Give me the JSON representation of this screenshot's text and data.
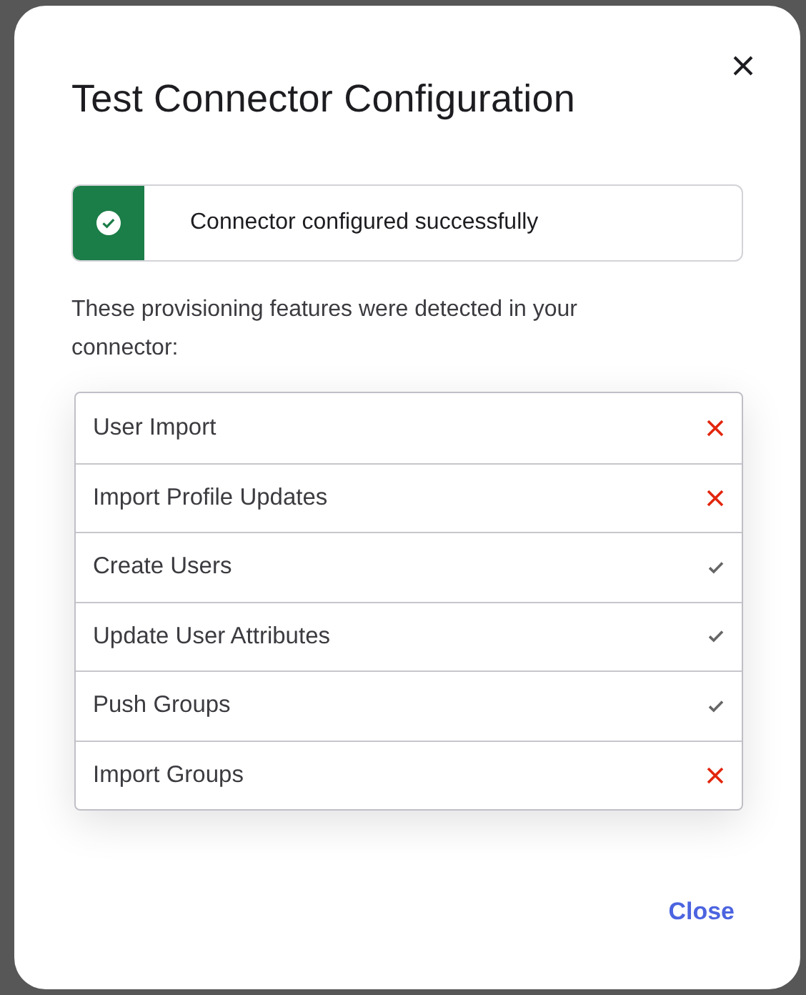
{
  "dialog": {
    "title": "Test Connector Configuration",
    "alert": {
      "kind": "success",
      "message": "Connector configured successfully"
    },
    "description": "These provisioning features were detected in your connector:",
    "features": [
      {
        "label": "User Import",
        "detected": false
      },
      {
        "label": "Import Profile Updates",
        "detected": false
      },
      {
        "label": "Create Users",
        "detected": true
      },
      {
        "label": "Update User Attributes",
        "detected": true
      },
      {
        "label": "Push Groups",
        "detected": true
      },
      {
        "label": "Import Groups",
        "detected": false
      }
    ],
    "close_link": "Close"
  }
}
